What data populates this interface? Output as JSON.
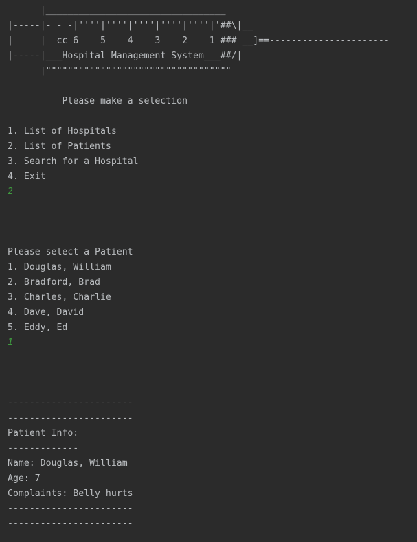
{
  "console": {
    "lines": [
      {
        "text": "      |_________________________________",
        "kind": "output"
      },
      {
        "text": "|-----|- - -|''''|''''|''''|''''|''''|'##\\|__",
        "kind": "output"
      },
      {
        "text": "|     |  cc 6    5    4    3    2    1 ### __]==----------------------",
        "kind": "output"
      },
      {
        "text": "|-----|___Hospital Management System___##/|",
        "kind": "output"
      },
      {
        "text": "      |\"\"\"\"\"\"\"\"\"\"\"\"\"\"\"\"\"\"\"\"\"\"\"\"\"\"\"\"\"\"\"\"\"\"",
        "kind": "output"
      },
      {
        "text": "",
        "kind": "output"
      },
      {
        "text": "          Please make a selection",
        "kind": "output"
      },
      {
        "text": "",
        "kind": "output"
      },
      {
        "text": "1. List of Hospitals",
        "kind": "output"
      },
      {
        "text": "2. List of Patients",
        "kind": "output"
      },
      {
        "text": "3. Search for a Hospital",
        "kind": "output"
      },
      {
        "text": "4. Exit",
        "kind": "output"
      },
      {
        "text": "2",
        "kind": "input"
      },
      {
        "text": "",
        "kind": "output"
      },
      {
        "text": "",
        "kind": "output"
      },
      {
        "text": "",
        "kind": "output"
      },
      {
        "text": "Please select a Patient",
        "kind": "output"
      },
      {
        "text": "1. Douglas, William",
        "kind": "output"
      },
      {
        "text": "2. Bradford, Brad",
        "kind": "output"
      },
      {
        "text": "3. Charles, Charlie",
        "kind": "output"
      },
      {
        "text": "4. Dave, David",
        "kind": "output"
      },
      {
        "text": "5. Eddy, Ed",
        "kind": "output"
      },
      {
        "text": "1",
        "kind": "input"
      },
      {
        "text": "",
        "kind": "output"
      },
      {
        "text": "",
        "kind": "output"
      },
      {
        "text": "",
        "kind": "output"
      },
      {
        "text": "-----------------------",
        "kind": "output"
      },
      {
        "text": "-----------------------",
        "kind": "output"
      },
      {
        "text": "Patient Info:",
        "kind": "output"
      },
      {
        "text": "-------------",
        "kind": "output"
      },
      {
        "text": "Name: Douglas, William",
        "kind": "output"
      },
      {
        "text": "Age: 7",
        "kind": "output"
      },
      {
        "text": "Complaints: Belly hurts",
        "kind": "output"
      },
      {
        "text": "-----------------------",
        "kind": "output"
      },
      {
        "text": "-----------------------",
        "kind": "output"
      }
    ]
  },
  "colors": {
    "background": "#2b2b2b",
    "output_text": "#b9bcbf",
    "user_input_text": "#3f9a3f"
  }
}
